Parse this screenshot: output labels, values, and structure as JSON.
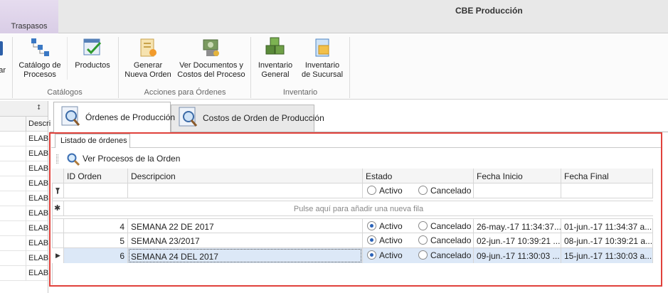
{
  "window": {
    "title": "CBE Producción"
  },
  "ribbon_tabs": [
    {
      "label": "Traspasos"
    }
  ],
  "ribbon": {
    "cut_label": "ar",
    "groups": [
      {
        "label": "Catálogos",
        "buttons": [
          {
            "label1": "Catálogo de",
            "label2": "Procesos",
            "icon": "process-catalog-icon"
          },
          {
            "label1": "Productos",
            "label2": "",
            "icon": "products-icon"
          }
        ]
      },
      {
        "label": "Acciones para Órdenes",
        "buttons": [
          {
            "label1": "Generar",
            "label2": "Nueva Orden",
            "icon": "new-order-icon"
          },
          {
            "label1": "Ver Documentos y",
            "label2": "Costos del Proceso",
            "icon": "documents-costs-icon"
          }
        ]
      },
      {
        "label": "Inventario",
        "buttons": [
          {
            "label1": "Inventario",
            "label2": "General",
            "icon": "general-inventory-icon"
          },
          {
            "label1": "Inventario",
            "label2": "de Sucursal",
            "icon": "branch-inventory-icon"
          }
        ]
      }
    ]
  },
  "left_panel": {
    "pin": "⭥",
    "column": "Descri",
    "rows": [
      "ELAB",
      "ELAB",
      "ELAB",
      "ELAB",
      "ELAB",
      "ELAB",
      "ELAB",
      "ELAB",
      "ELAB",
      "ELAB"
    ]
  },
  "doc_tabs": [
    {
      "label": "Órdenes de Producción",
      "icon": "search-document-icon",
      "active": true
    },
    {
      "label": "Costos de Orden de Producción",
      "icon": "search-document-icon",
      "active": false
    }
  ],
  "inner_tab": {
    "label": "Listado de órdenes"
  },
  "toolbar": {
    "view_processes": "Ver Procesos de la Orden"
  },
  "grid": {
    "columns": [
      "ID Orden",
      "Descripcion",
      "Estado",
      "Fecha Inicio",
      "Fecha Final"
    ],
    "filter_row_icon": "filter-icon",
    "filter_options": [
      "Activo",
      "Cancelado"
    ],
    "new_row_hint": "Pulse aquí para añadir una nueva fila",
    "new_row_icon": "new-row-icon",
    "rows": [
      {
        "id": "4",
        "descripcion": "SEMANA 22 DE 2017",
        "estado": "Activo",
        "option1": "Activo",
        "option2": "Cancelado",
        "fecha_inicio": "26-may.-17 11:34:37...",
        "fecha_final": "01-jun.-17 11:34:37 a..."
      },
      {
        "id": "5",
        "descripcion": "SEMANA 23/2017",
        "estado": "Activo",
        "option1": "Activo",
        "option2": "Cancelado",
        "fecha_inicio": "02-jun.-17 10:39:21 ...",
        "fecha_final": "08-jun.-17 10:39:21 a..."
      },
      {
        "id": "6",
        "descripcion": "SEMANA 24 DEL 2017",
        "estado": "Activo",
        "option1": "Activo",
        "option2": "Cancelado",
        "fecha_inicio": "09-jun.-17 11:30:03 ...",
        "fecha_final": "15-jun.-17 11:30:03 a...",
        "selected": true
      }
    ]
  },
  "colors": {
    "highlight_frame": "#e0413b",
    "selected_row": "#dce8f7",
    "app_menu": "#d9cde6"
  }
}
